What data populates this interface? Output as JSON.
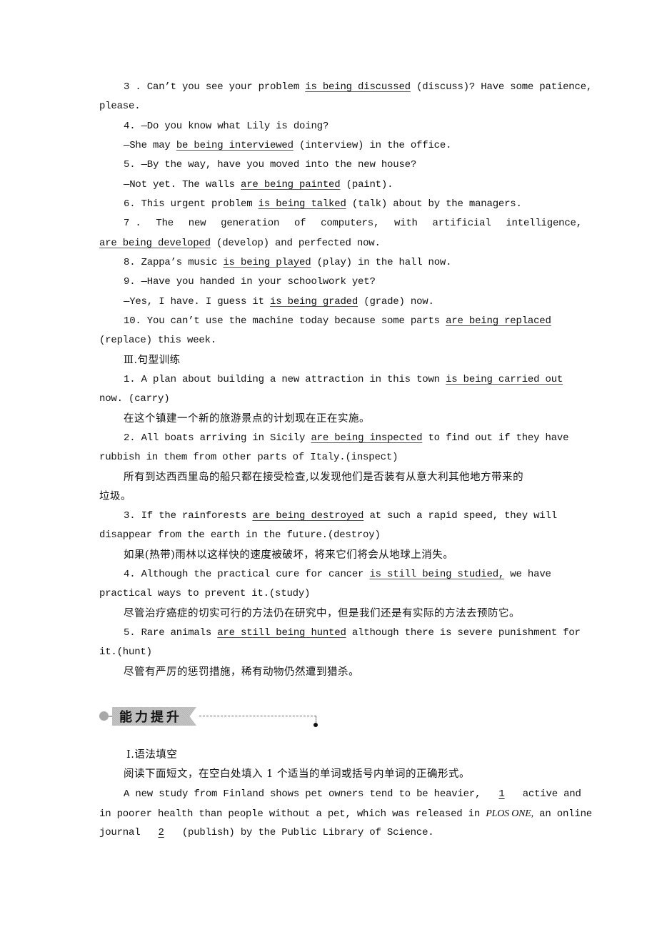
{
  "section2": {
    "items": [
      {
        "pre": "3 . Can’t you see your problem ",
        "ans": "is being discussed",
        "post": " (discuss)? Have some patience,",
        "cont": "please."
      },
      {
        "pre": "4. —Do you know what Lily is doing?"
      },
      {
        "pre": "—She may ",
        "ans": "be being interviewed",
        "post": " (interview) in the office."
      },
      {
        "pre": "5. —By the way, have you moved into the new house?"
      },
      {
        "pre": "—Not yet. The walls ",
        "ans": "are being painted",
        "post": " (paint)."
      },
      {
        "pre": "6. This urgent problem ",
        "ans": "is being talked",
        "post": " (talk) about by the managers."
      },
      {
        "words": [
          "7 .",
          "The",
          "new",
          "generation",
          "of",
          "computers,",
          "with",
          "artificial",
          "intelligence,"
        ],
        "ans": "are being developed",
        "post": " (develop) and perfected now."
      },
      {
        "pre": "8. Zappa’s music ",
        "ans": "is being played",
        "post": " (play) in the hall now."
      },
      {
        "pre": "9. —Have you handed in your schoolwork yet?"
      },
      {
        "pre": "—Yes, I have. I guess it ",
        "ans": "is being graded",
        "post": " (grade) now."
      },
      {
        "pre": "10. You can’t use the machine today because some parts ",
        "ans": "are being replaced",
        "cont": "(replace) this week."
      }
    ]
  },
  "section3": {
    "heading": "Ⅲ.句型训练",
    "items": [
      {
        "pre": "1. A plan about building a new attraction in this town ",
        "ans": "is being carried out",
        "cont": "now. (carry)",
        "cn": "在这个镇建一个新的旅游景点的计划现在正在实施。"
      },
      {
        "pre": "2. All boats arriving in Sicily ",
        "ans": "are being inspected",
        "post": " to find out if they have",
        "cont": "rubbish in them from other parts of Italy.(inspect)",
        "cn": "所有到达西西里岛的船只都在接受检查,以发现他们是否装有从意大利其他地方带来的",
        "cn2": "垃圾。"
      },
      {
        "pre": "3. If the rainforests ",
        "ans": "are being destroyed",
        "post": " at such a rapid speed, they will",
        "cont": "disappear from the earth in the future.(destroy)",
        "cn": "如果(热带)雨林以这样快的速度被破坏，将来它们将会从地球上消失。"
      },
      {
        "pre": "4. Although the practical cure for cancer ",
        "ans": "is still being studied,",
        "post": " we have",
        "cont": "practical ways to prevent it.(study)",
        "cn": "尽管治疗癌症的切实可行的方法仍在研究中，但是我们还是有实际的方法去预防它。"
      },
      {
        "pre": "5. Rare animals ",
        "ans": "are still being hunted",
        "post": " although there is severe punishment for",
        "cont": "it.(hunt)",
        "cn": "尽管有严厉的惩罚措施，稀有动物仍然遭到猎杀。"
      }
    ]
  },
  "banner": {
    "title": "能力提升"
  },
  "section4": {
    "heading": "Ⅰ.语法填空",
    "instruction": "阅读下面短文，在空白处填入 1 个适当的单词或括号内单词的正确形式。",
    "p1a": "A new study from Finland shows pet owners tend to be heavier, ",
    "blank1": "1",
    "p1b": " active and",
    "p2a": "in poorer health than people without a pet, which was released in ",
    "p2it": "PLOS ONE,",
    "p2b": " an online",
    "p3a": "journal ",
    "blank2": "2",
    "p3b": " (publish) by the Public Library of  Science."
  }
}
